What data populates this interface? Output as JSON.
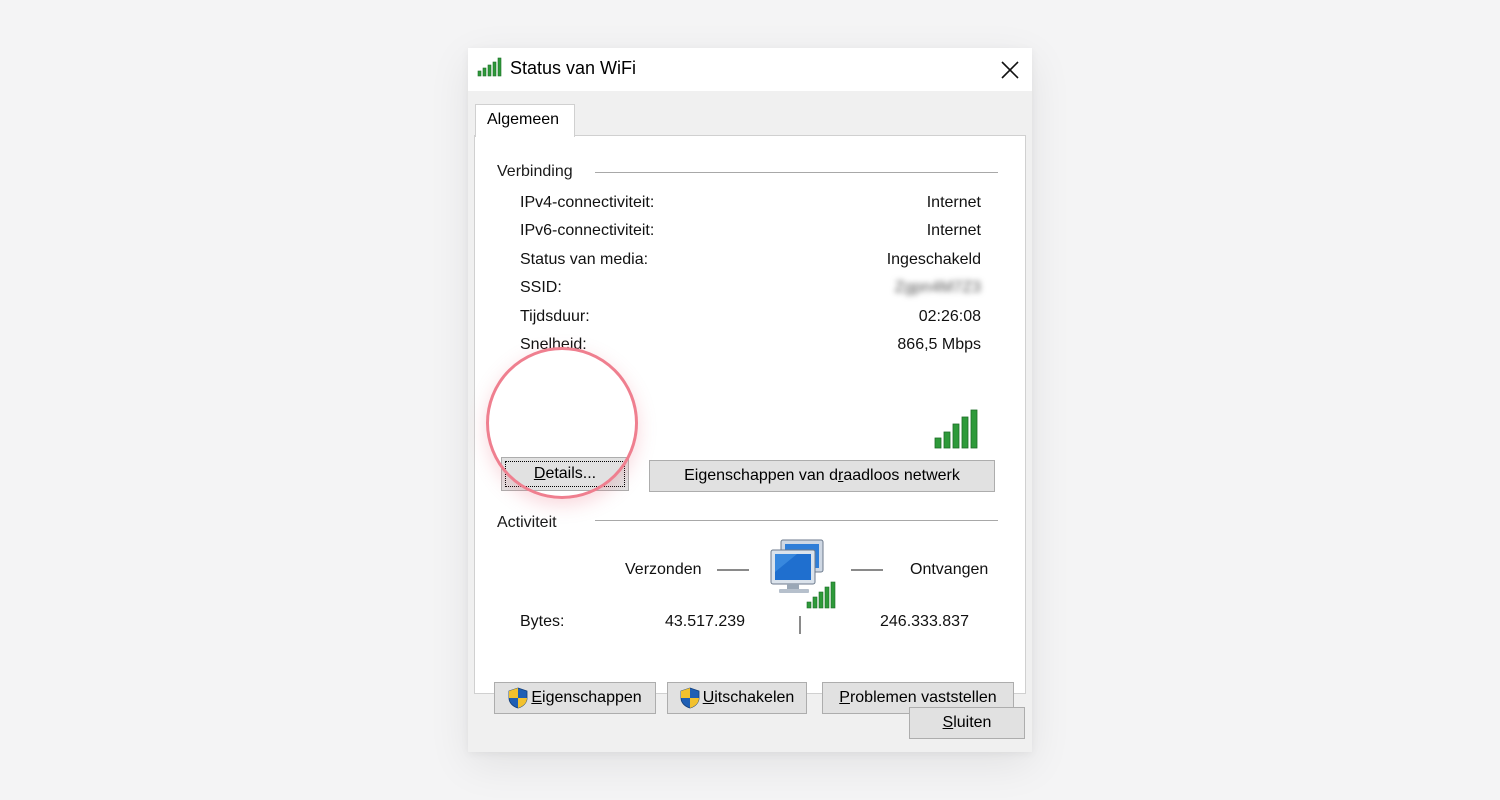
{
  "window": {
    "title": "Status van WiFi",
    "icon": "wifi-signal-icon",
    "close_icon": "close-icon"
  },
  "tabs": [
    {
      "label": "Algemeen",
      "active": true
    }
  ],
  "connection": {
    "heading": "Verbinding",
    "rows": [
      {
        "label": "IPv4-connectiviteit:",
        "value": "Internet"
      },
      {
        "label": "IPv6-connectiviteit:",
        "value": "Internet"
      },
      {
        "label": "Status van media:",
        "value": "Ingeschakeld"
      },
      {
        "label": "SSID:",
        "value": "Zgpn4M7Z3"
      },
      {
        "label": "Tijdsduur:",
        "value": "02:26:08"
      },
      {
        "label": "Snelheid:",
        "value": "866,5 Mbps"
      }
    ],
    "signal_bars": 5,
    "details_button": {
      "prefix": "",
      "u": "D",
      "rest": "etails..."
    },
    "wireless_button": {
      "prefix": "Eigenschappen van d",
      "u": "r",
      "rest": "aadloos netwerk"
    }
  },
  "activity": {
    "heading": "Activiteit",
    "sent_label": "Verzonden",
    "received_label": "Ontvangen",
    "bytes_label": "Bytes:",
    "bytes_sent": "43.517.239",
    "bytes_received": "246.333.837"
  },
  "bottom_buttons": {
    "properties": {
      "u": "E",
      "rest": "igenschappen"
    },
    "disable": {
      "u": "U",
      "rest": "itschakelen"
    },
    "diagnose": {
      "u": "P",
      "rest": "roblemen vaststellen"
    }
  },
  "close_button": {
    "u": "S",
    "rest": "luiten"
  },
  "colors": {
    "highlight": "#ef7f8f",
    "signal_green": "#2e9a3a",
    "button_face": "#e1e1e1"
  }
}
